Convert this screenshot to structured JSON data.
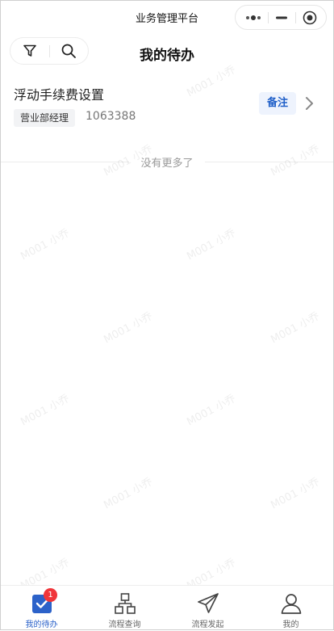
{
  "window": {
    "title": "业务管理平台"
  },
  "header": {
    "title": "我的待办"
  },
  "task": {
    "title": "浮动手续费设置",
    "tag": "营业部经理",
    "number": "1063388",
    "remark_label": "备注"
  },
  "list": {
    "no_more_text": "没有更多了"
  },
  "watermark": {
    "text": "M001 小乔"
  },
  "tabs": [
    {
      "label": "我的待办",
      "icon": "todo-check-icon",
      "badge": "1",
      "active": true
    },
    {
      "label": "流程查询",
      "icon": "flow-tree-icon",
      "active": false
    },
    {
      "label": "流程发起",
      "icon": "paper-plane-icon",
      "active": false
    },
    {
      "label": "我的",
      "icon": "user-icon",
      "active": false
    }
  ],
  "colors": {
    "accent": "#2c62c9",
    "badge": "#f0353a",
    "remark_bg": "#eef3fd"
  }
}
